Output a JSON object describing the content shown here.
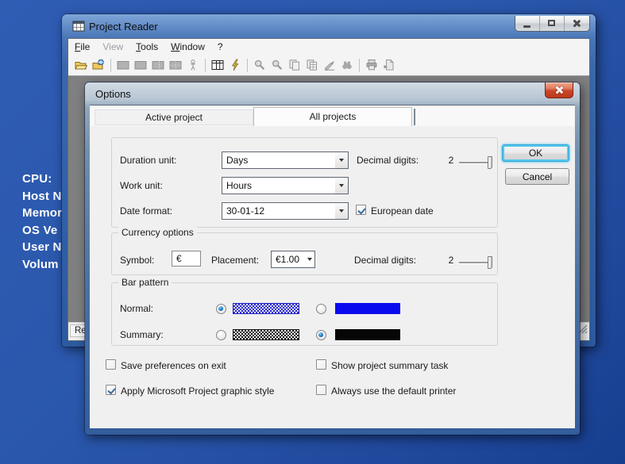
{
  "desktop": {
    "info_lines": [
      "CPU:",
      "Host N",
      "Memor",
      "OS Ve",
      "User N",
      "Volum"
    ]
  },
  "colors": {
    "desktop_blue": "#2a57ab",
    "window_frame_blue": "#3a67ac",
    "dialog_close_red": "#cc4526",
    "ok_focus_ring": "#56c6ee",
    "bar_normal_blue": "#0a0aee",
    "bar_summary_black": "#060606",
    "check_mark_blue": "#3c6b9e"
  },
  "main_window": {
    "title": "Project Reader",
    "menu": {
      "items": [
        {
          "label": "File",
          "enabled": true
        },
        {
          "label": "View",
          "enabled": false
        },
        {
          "label": "Tools",
          "enabled": true
        },
        {
          "label": "Window",
          "enabled": true
        },
        {
          "label": "?",
          "enabled": true
        }
      ]
    },
    "toolbar": {
      "icons": [
        {
          "name": "open-folder-icon",
          "enabled": true
        },
        {
          "name": "open-web-folder-icon",
          "enabled": true
        },
        {
          "name": "gantt-view-icon",
          "enabled": false
        },
        {
          "name": "task-view-icon",
          "enabled": false
        },
        {
          "name": "split-view-icon",
          "enabled": false
        },
        {
          "name": "grid-view-icon",
          "enabled": false
        },
        {
          "name": "resource-person-icon",
          "enabled": false
        },
        {
          "name": "table-icon",
          "enabled": true
        },
        {
          "name": "lightning-icon",
          "enabled": true
        },
        {
          "name": "zoom-in-icon",
          "enabled": false
        },
        {
          "name": "zoom-out-icon",
          "enabled": false
        },
        {
          "name": "copy-icon",
          "enabled": false
        },
        {
          "name": "copy-table-icon",
          "enabled": false
        },
        {
          "name": "export-icon",
          "enabled": false
        },
        {
          "name": "binoculars-icon",
          "enabled": false
        },
        {
          "name": "printer-icon",
          "enabled": false
        },
        {
          "name": "print-preview-icon",
          "enabled": false
        }
      ]
    },
    "status": {
      "text": "Rea"
    }
  },
  "dialog": {
    "title": "Options",
    "tabs": [
      {
        "label": "Active project",
        "selected": false
      },
      {
        "label": "All projects",
        "selected": true
      }
    ],
    "general": {
      "duration_label": "Duration unit:",
      "duration_value": "Days",
      "work_label": "Work unit:",
      "work_value": "Hours",
      "date_label": "Date format:",
      "date_value": "30-01-12",
      "european_date_label": "European date",
      "european_date_checked": true,
      "decimal_label": "Decimal digits:",
      "decimal_value": "2"
    },
    "buttons": {
      "ok": "OK",
      "cancel": "Cancel"
    },
    "currency": {
      "group_label": "Currency options",
      "symbol_label": "Symbol:",
      "symbol_value": "€",
      "placement_label": "Placement:",
      "placement_value": "€1.00",
      "decimal_label": "Decimal digits:",
      "decimal_value": "2"
    },
    "bar_pattern": {
      "group_label": "Bar pattern",
      "normal_label": "Normal:",
      "summary_label": "Summary:",
      "normal_selected": "hatched",
      "summary_selected": "solid"
    },
    "checkboxes": [
      {
        "label": "Save preferences on exit",
        "checked": false
      },
      {
        "label": "Show project summary task",
        "checked": false
      },
      {
        "label": "Apply Microsoft Project graphic style",
        "checked": true
      },
      {
        "label": "Always use the default printer",
        "checked": false
      }
    ]
  }
}
